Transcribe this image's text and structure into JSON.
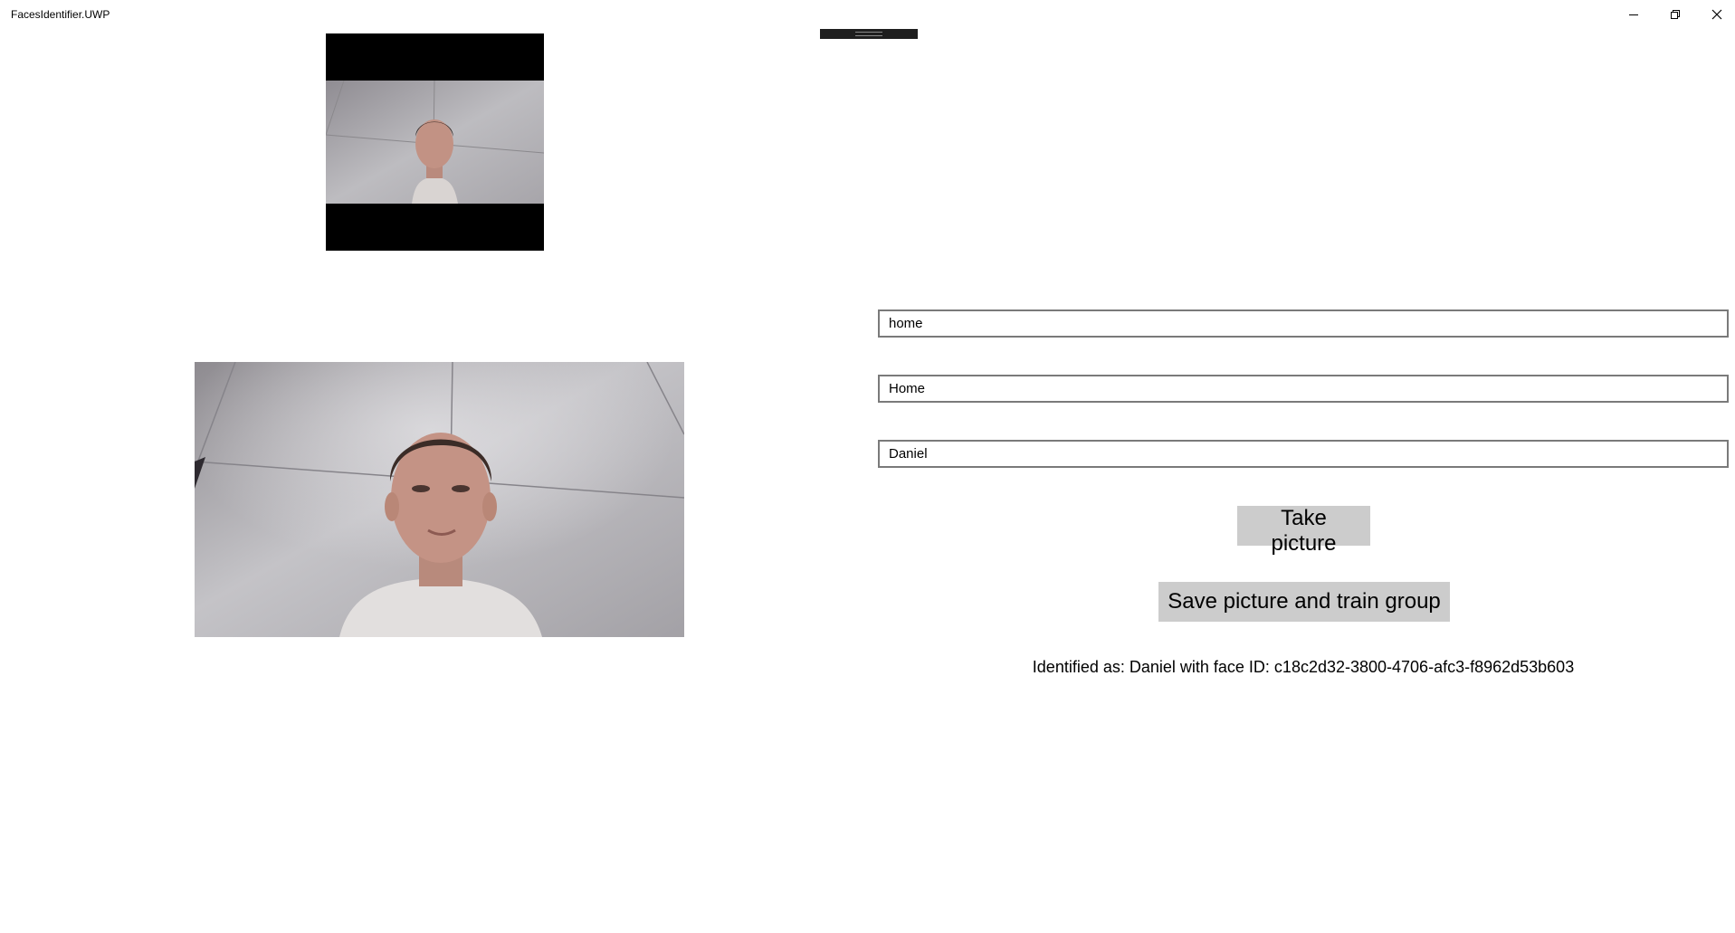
{
  "window": {
    "title": "FacesIdentifier.UWP",
    "caption_buttons": [
      "minimize-icon",
      "restore-icon",
      "close-icon"
    ]
  },
  "previews": {
    "small_label": "",
    "large_label": ""
  },
  "form": {
    "group_id_value": "home",
    "group_name_value": "Home",
    "person_name_value": "Daniel"
  },
  "actions": {
    "take_picture_label": "Take picture",
    "save_train_label": "Save picture and train group"
  },
  "status": {
    "identified_text": "Identified as: Daniel with face ID: c18c2d32-3800-4706-afc3-f8962d53b603"
  }
}
